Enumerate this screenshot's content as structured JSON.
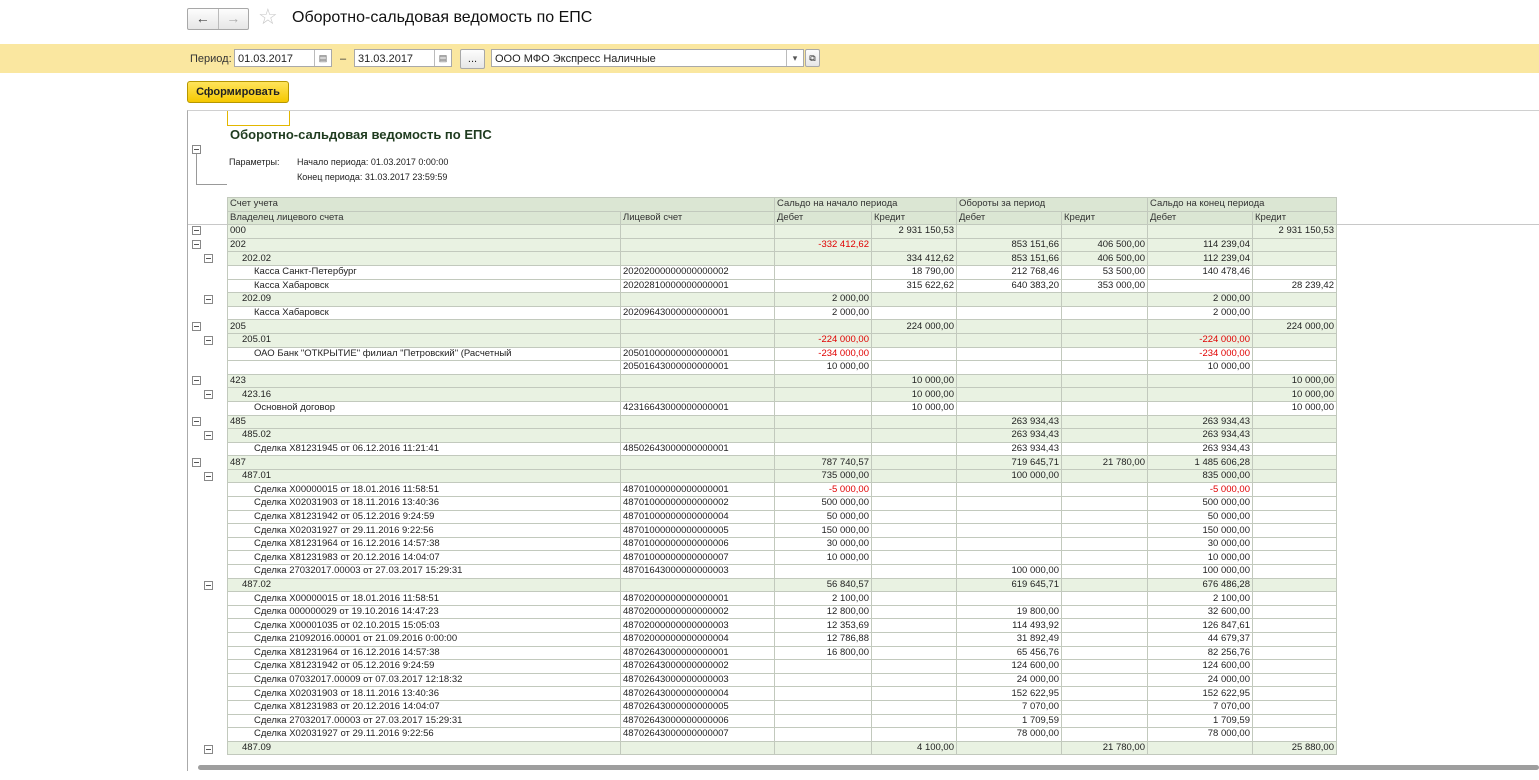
{
  "window": {
    "title": "Оборотно-сальдовая ведомость по ЕПС",
    "back_icon": "arrow-left",
    "forward_icon": "arrow-right",
    "favorite_icon": "star"
  },
  "filters": {
    "period_label": "Период:",
    "date_from": "01.03.2017",
    "dash": "–",
    "date_to": "31.03.2017",
    "more_label": "...",
    "organization": "ООО МФО Экспресс Наличные"
  },
  "toolbar": {
    "generate_label": "Сформировать"
  },
  "report": {
    "title": "Оборотно-сальдовая ведомость по ЕПС",
    "params_label": "Параметры:",
    "period_start": "Начало периода: 01.03.2017 0:00:00",
    "period_end": "Конец периода: 31.03.2017 23:59:59",
    "headers": {
      "account": "Счет учета",
      "owner": "Владелец лицевого счета",
      "personal_account": "Лицевой счет",
      "opening": "Сальдо на начало периода",
      "turnover": "Обороты за период",
      "closing": "Сальдо на конец периода",
      "debit": "Дебет",
      "credit": "Кредит"
    },
    "rows": [
      {
        "lvl": 0,
        "grp": true,
        "name": "000",
        "acc": "",
        "v": [
          "",
          "2 931 150,53",
          "",
          "",
          "",
          "2 931 150,53"
        ]
      },
      {
        "lvl": 0,
        "grp": true,
        "name": "202",
        "acc": "",
        "v": [
          "-332 412,62",
          "",
          "853 151,66",
          "406 500,00",
          "114 239,04",
          ""
        ]
      },
      {
        "lvl": 1,
        "grp": true,
        "name": "202.02",
        "acc": "",
        "v": [
          "",
          "334 412,62",
          "853 151,66",
          "406 500,00",
          "112 239,04",
          ""
        ]
      },
      {
        "lvl": 2,
        "grp": false,
        "name": "Касса Санкт-Петербург",
        "acc": "20202000000000000002",
        "v": [
          "",
          "18 790,00",
          "212 768,46",
          "53 500,00",
          "140 478,46",
          ""
        ]
      },
      {
        "lvl": 2,
        "grp": false,
        "name": "Касса Хабаровск",
        "acc": "20202810000000000001",
        "v": [
          "",
          "315 622,62",
          "640 383,20",
          "353 000,00",
          "",
          "28 239,42"
        ]
      },
      {
        "lvl": 1,
        "grp": true,
        "name": "202.09",
        "acc": "",
        "v": [
          "2 000,00",
          "",
          "",
          "",
          "2 000,00",
          ""
        ]
      },
      {
        "lvl": 2,
        "grp": false,
        "name": "Касса Хабаровск",
        "acc": "20209643000000000001",
        "v": [
          "2 000,00",
          "",
          "",
          "",
          "2 000,00",
          ""
        ]
      },
      {
        "lvl": 0,
        "grp": true,
        "name": "205",
        "acc": "",
        "v": [
          "",
          "224 000,00",
          "",
          "",
          "",
          "224 000,00"
        ]
      },
      {
        "lvl": 1,
        "grp": true,
        "name": "205.01",
        "acc": "",
        "v": [
          "-224 000,00",
          "",
          "",
          "",
          "-224 000,00",
          ""
        ]
      },
      {
        "lvl": 2,
        "grp": false,
        "name": "ОАО Банк \"ОТКРЫТИЕ\" филиал \"Петровский\" (Расчетный",
        "acc": "20501000000000000001",
        "v": [
          "-234 000,00",
          "",
          "",
          "",
          "-234 000,00",
          ""
        ]
      },
      {
        "lvl": 2,
        "grp": false,
        "name": "",
        "acc": "20501643000000000001",
        "v": [
          "10 000,00",
          "",
          "",
          "",
          "10 000,00",
          ""
        ]
      },
      {
        "lvl": 0,
        "grp": true,
        "name": "423",
        "acc": "",
        "v": [
          "",
          "10 000,00",
          "",
          "",
          "",
          "10 000,00"
        ]
      },
      {
        "lvl": 1,
        "grp": true,
        "name": "423.16",
        "acc": "",
        "v": [
          "",
          "10 000,00",
          "",
          "",
          "",
          "10 000,00"
        ]
      },
      {
        "lvl": 2,
        "grp": false,
        "name": "Основной договор",
        "acc": "42316643000000000001",
        "v": [
          "",
          "10 000,00",
          "",
          "",
          "",
          "10 000,00"
        ]
      },
      {
        "lvl": 0,
        "grp": true,
        "name": "485",
        "acc": "",
        "v": [
          "",
          "",
          "263 934,43",
          "",
          "263 934,43",
          ""
        ]
      },
      {
        "lvl": 1,
        "grp": true,
        "name": "485.02",
        "acc": "",
        "v": [
          "",
          "",
          "263 934,43",
          "",
          "263 934,43",
          ""
        ]
      },
      {
        "lvl": 2,
        "grp": false,
        "name": "Сделка Х81231945 от 06.12.2016 11:21:41",
        "acc": "48502643000000000001",
        "v": [
          "",
          "",
          "263 934,43",
          "",
          "263 934,43",
          ""
        ]
      },
      {
        "lvl": 0,
        "grp": true,
        "name": "487",
        "acc": "",
        "v": [
          "787 740,57",
          "",
          "719 645,71",
          "21 780,00",
          "1 485 606,28",
          ""
        ]
      },
      {
        "lvl": 1,
        "grp": true,
        "name": "487.01",
        "acc": "",
        "v": [
          "735 000,00",
          "",
          "100 000,00",
          "",
          "835 000,00",
          ""
        ]
      },
      {
        "lvl": 2,
        "grp": false,
        "name": "Сделка Х00000015 от 18.01.2016 11:58:51",
        "acc": "48701000000000000001",
        "v": [
          "-5 000,00",
          "",
          "",
          "",
          "-5 000,00",
          ""
        ]
      },
      {
        "lvl": 2,
        "grp": false,
        "name": "Сделка Х02031903 от 18.11.2016 13:40:36",
        "acc": "48701000000000000002",
        "v": [
          "500 000,00",
          "",
          "",
          "",
          "500 000,00",
          ""
        ]
      },
      {
        "lvl": 2,
        "grp": false,
        "name": "Сделка Х81231942 от 05.12.2016 9:24:59",
        "acc": "48701000000000000004",
        "v": [
          "50 000,00",
          "",
          "",
          "",
          "50 000,00",
          ""
        ]
      },
      {
        "lvl": 2,
        "grp": false,
        "name": "Сделка Х02031927 от 29.11.2016 9:22:56",
        "acc": "48701000000000000005",
        "v": [
          "150 000,00",
          "",
          "",
          "",
          "150 000,00",
          ""
        ]
      },
      {
        "lvl": 2,
        "grp": false,
        "name": "Сделка Х81231964 от 16.12.2016 14:57:38",
        "acc": "48701000000000000006",
        "v": [
          "30 000,00",
          "",
          "",
          "",
          "30 000,00",
          ""
        ]
      },
      {
        "lvl": 2,
        "grp": false,
        "name": "Сделка Х81231983 от 20.12.2016 14:04:07",
        "acc": "48701000000000000007",
        "v": [
          "10 000,00",
          "",
          "",
          "",
          "10 000,00",
          ""
        ]
      },
      {
        "lvl": 2,
        "grp": false,
        "name": "Сделка 27032017.00003 от 27.03.2017 15:29:31",
        "acc": "48701643000000000003",
        "v": [
          "",
          "",
          "100 000,00",
          "",
          "100 000,00",
          ""
        ]
      },
      {
        "lvl": 1,
        "grp": true,
        "name": "487.02",
        "acc": "",
        "v": [
          "56 840,57",
          "",
          "619 645,71",
          "",
          "676 486,28",
          ""
        ]
      },
      {
        "lvl": 2,
        "grp": false,
        "name": "Сделка Х00000015 от 18.01.2016 11:58:51",
        "acc": "48702000000000000001",
        "v": [
          "2 100,00",
          "",
          "",
          "",
          "2 100,00",
          ""
        ]
      },
      {
        "lvl": 2,
        "grp": false,
        "name": "Сделка 000000029 от 19.10.2016 14:47:23",
        "acc": "48702000000000000002",
        "v": [
          "12 800,00",
          "",
          "19 800,00",
          "",
          "32 600,00",
          ""
        ]
      },
      {
        "lvl": 2,
        "grp": false,
        "name": "Сделка Х00001035 от 02.10.2015 15:05:03",
        "acc": "48702000000000000003",
        "v": [
          "12 353,69",
          "",
          "114 493,92",
          "",
          "126 847,61",
          ""
        ]
      },
      {
        "lvl": 2,
        "grp": false,
        "name": "Сделка 21092016.00001 от 21.09.2016 0:00:00",
        "acc": "48702000000000000004",
        "v": [
          "12 786,88",
          "",
          "31 892,49",
          "",
          "44 679,37",
          ""
        ]
      },
      {
        "lvl": 2,
        "grp": false,
        "name": "Сделка Х81231964 от 16.12.2016 14:57:38",
        "acc": "48702643000000000001",
        "v": [
          "16 800,00",
          "",
          "65 456,76",
          "",
          "82 256,76",
          ""
        ]
      },
      {
        "lvl": 2,
        "grp": false,
        "name": "Сделка Х81231942 от 05.12.2016 9:24:59",
        "acc": "48702643000000000002",
        "v": [
          "",
          "",
          "124 600,00",
          "",
          "124 600,00",
          ""
        ]
      },
      {
        "lvl": 2,
        "grp": false,
        "name": "Сделка 07032017.00009 от 07.03.2017 12:18:32",
        "acc": "48702643000000000003",
        "v": [
          "",
          "",
          "24 000,00",
          "",
          "24 000,00",
          ""
        ]
      },
      {
        "lvl": 2,
        "grp": false,
        "name": "Сделка Х02031903 от 18.11.2016 13:40:36",
        "acc": "48702643000000000004",
        "v": [
          "",
          "",
          "152 622,95",
          "",
          "152 622,95",
          ""
        ]
      },
      {
        "lvl": 2,
        "grp": false,
        "name": "Сделка Х81231983 от 20.12.2016 14:04:07",
        "acc": "48702643000000000005",
        "v": [
          "",
          "",
          "7 070,00",
          "",
          "7 070,00",
          ""
        ]
      },
      {
        "lvl": 2,
        "grp": false,
        "name": "Сделка 27032017.00003 от 27.03.2017 15:29:31",
        "acc": "48702643000000000006",
        "v": [
          "",
          "",
          "1 709,59",
          "",
          "1 709,59",
          ""
        ]
      },
      {
        "lvl": 2,
        "grp": false,
        "name": "Сделка Х02031927 от 29.11.2016 9:22:56",
        "acc": "48702643000000000007",
        "v": [
          "",
          "",
          "78 000,00",
          "",
          "78 000,00",
          ""
        ]
      },
      {
        "lvl": 1,
        "grp": true,
        "name": "487.09",
        "acc": "",
        "v": [
          "",
          "4 100,00",
          "",
          "21 780,00",
          "",
          "25 880,00"
        ]
      }
    ]
  }
}
